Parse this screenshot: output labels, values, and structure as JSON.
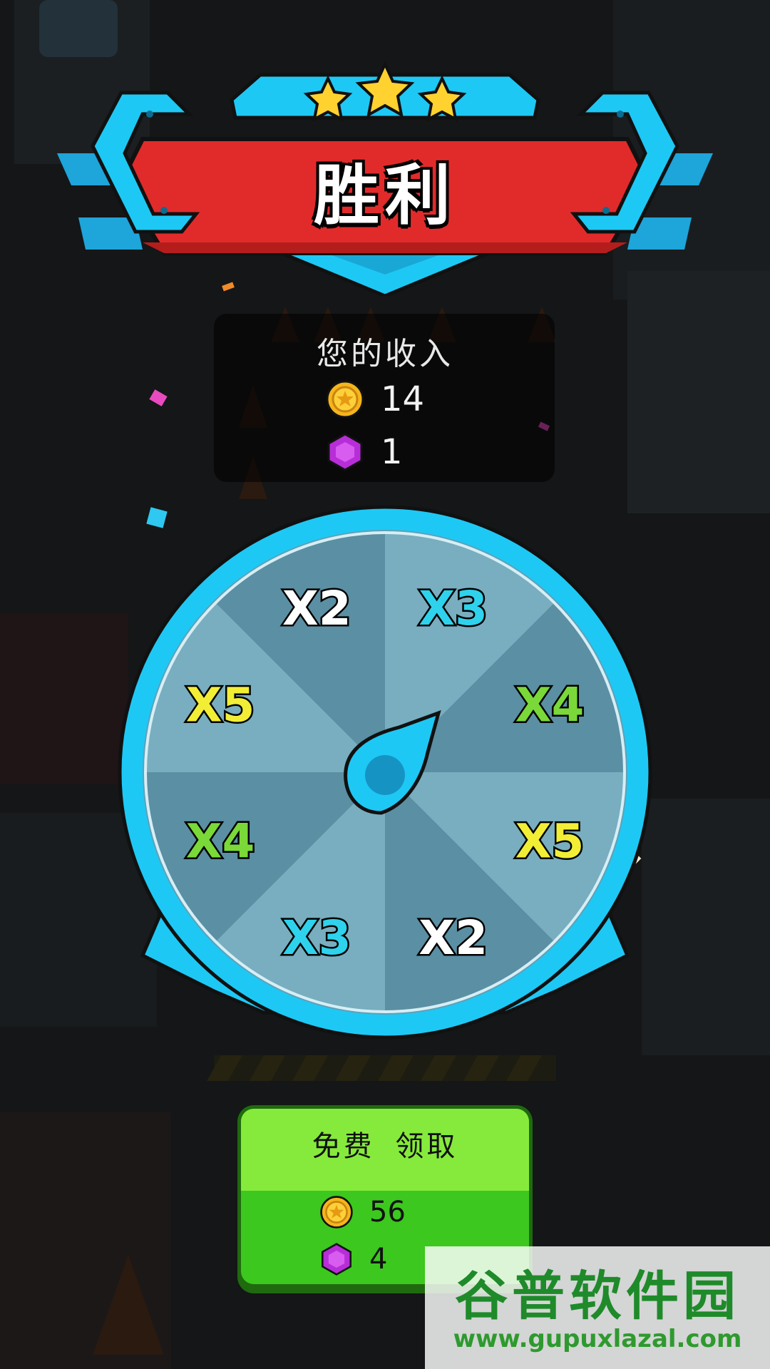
{
  "header": {
    "title": "胜利",
    "stars": 3
  },
  "income": {
    "label": "您的收入",
    "coins": "14",
    "gems": "1"
  },
  "wheel": {
    "segments": [
      {
        "label": "X2",
        "color": "#ffffff"
      },
      {
        "label": "X3",
        "color": "#2ed2ec"
      },
      {
        "label": "X4",
        "color": "#7ad838"
      },
      {
        "label": "X5",
        "color": "#f2ee36"
      },
      {
        "label": "X2",
        "color": "#ffffff"
      },
      {
        "label": "X3",
        "color": "#2ed2ec"
      },
      {
        "label": "X4",
        "color": "#7ad838"
      },
      {
        "label": "X5",
        "color": "#f2ee36"
      }
    ]
  },
  "claim": {
    "label": "免费  领取",
    "coins": "56",
    "gems": "4"
  },
  "watermark": {
    "logo": "谷普软件园",
    "url": "www.gupuxlazal.com"
  },
  "colors": {
    "banner_red": "#e12b2b",
    "banner_blue": "#1ec8f4",
    "wheel_rim": "#1ec8f4",
    "claim_green": "#86ea3c"
  },
  "icons": {
    "coin": "coin-icon",
    "gem": "gem-icon",
    "star": "star-icon",
    "pointer": "wheel-pointer-icon"
  }
}
